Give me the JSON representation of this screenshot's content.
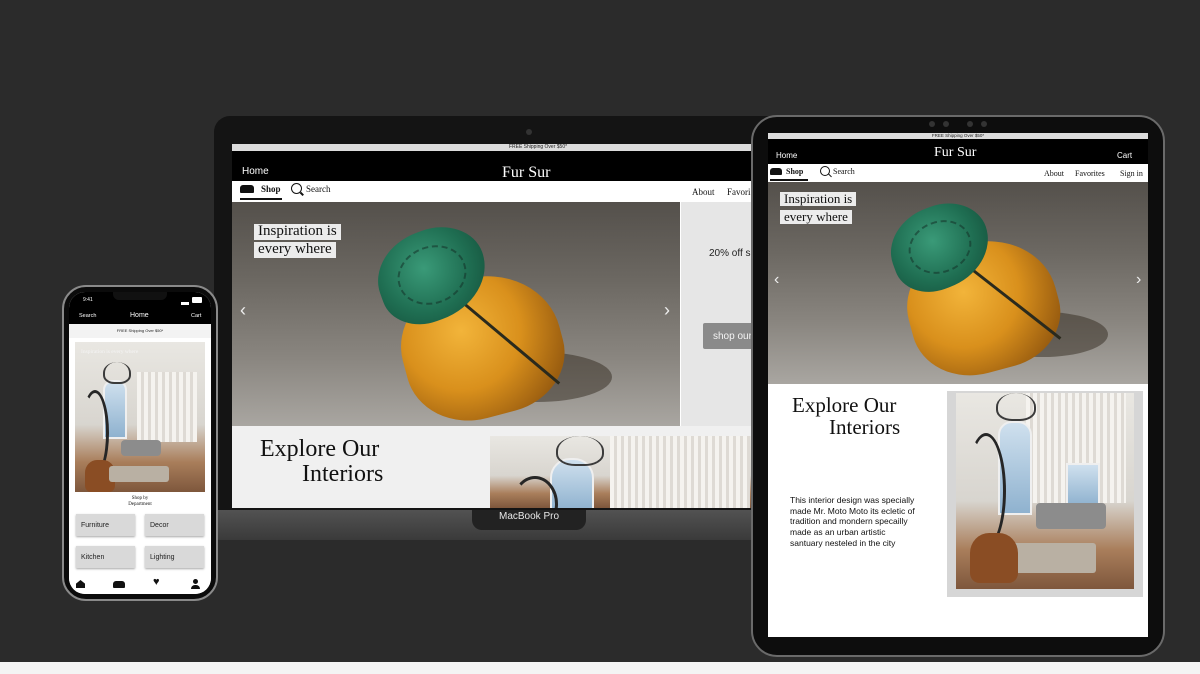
{
  "brand": "Fur Sur",
  "promo": "FREE Shipping Over $50*",
  "laptop": {
    "device_label": "MacBook Pro",
    "nav": {
      "home": "Home",
      "shop": "Shop",
      "search": "Search",
      "about": "About",
      "favorites": "Favori"
    },
    "hero": {
      "caption_line1": "Inspiration is",
      "caption_line2": "every where",
      "prev": "‹",
      "next": "›"
    },
    "side_promo": {
      "text": "20% off s",
      "button": "shop our"
    },
    "explore": {
      "line1": "Explore Our",
      "line2": "Interiors"
    }
  },
  "tablet": {
    "nav": {
      "home": "Home",
      "cart": "Cart",
      "shop": "Shop",
      "search": "Search",
      "about": "About",
      "favorites": "Favorites",
      "sign_in": "Sign in"
    },
    "hero": {
      "caption_line1": "Inspiration is",
      "caption_line2": "every where",
      "prev": "‹",
      "next": "›"
    },
    "explore": {
      "line1": "Explore Our",
      "line2": "Interiors"
    },
    "description": "This interior design was specially made Mr. Moto Moto its ecletic of tradition and mondern specailly made as an urban artistic santuary nesteled in the city"
  },
  "phone": {
    "time": "9:41",
    "nav": {
      "search": "Search",
      "title": "Home",
      "cart": "Cart"
    },
    "hero_caption": "Inspiration is every where",
    "section_line1": "Shop by",
    "section_line2": "Department",
    "departments": [
      "Furniture",
      "Decor",
      "Kitchen",
      "Lighting"
    ],
    "tabbar_icons": [
      "home-icon",
      "sofa-icon",
      "heart-icon",
      "person-icon"
    ]
  }
}
